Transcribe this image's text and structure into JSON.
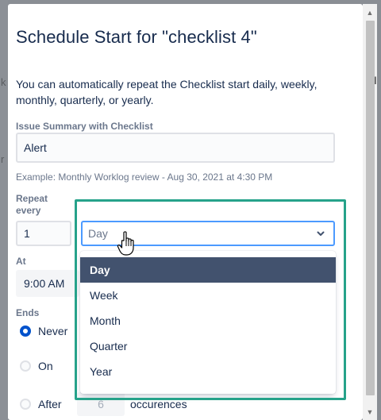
{
  "dialog": {
    "title": "Schedule Start for \"checklist 4\"",
    "description": "You can automatically repeat the Checklist start daily, weekly, monthly, quarterly, or yearly."
  },
  "summary": {
    "label": "Issue Summary with Checklist",
    "value": "Alert",
    "helper": "Example: Monthly Worklog review - Aug 30, 2021 at 4:30 PM"
  },
  "repeat": {
    "label": "Repeat every",
    "count": "1",
    "unit_value": "Day",
    "options": [
      "Day",
      "Week",
      "Month",
      "Quarter",
      "Year"
    ],
    "selected_index": 0
  },
  "at": {
    "label": "At",
    "time": "9:00 AM"
  },
  "ends": {
    "label": "Ends",
    "options": [
      {
        "label": "Never",
        "checked": true
      },
      {
        "label": "On",
        "checked": false
      },
      {
        "label": "After",
        "checked": false
      }
    ],
    "occurrences_value": "6",
    "occurrences_label": "occurences"
  },
  "icons": {
    "caret": "chevron-down-icon",
    "cursor": "hand-pointer-icon"
  },
  "colors": {
    "accent": "#0052cc",
    "focus": "#4c9aff",
    "highlight": "#26a28a",
    "selected_bg": "#42526e"
  }
}
